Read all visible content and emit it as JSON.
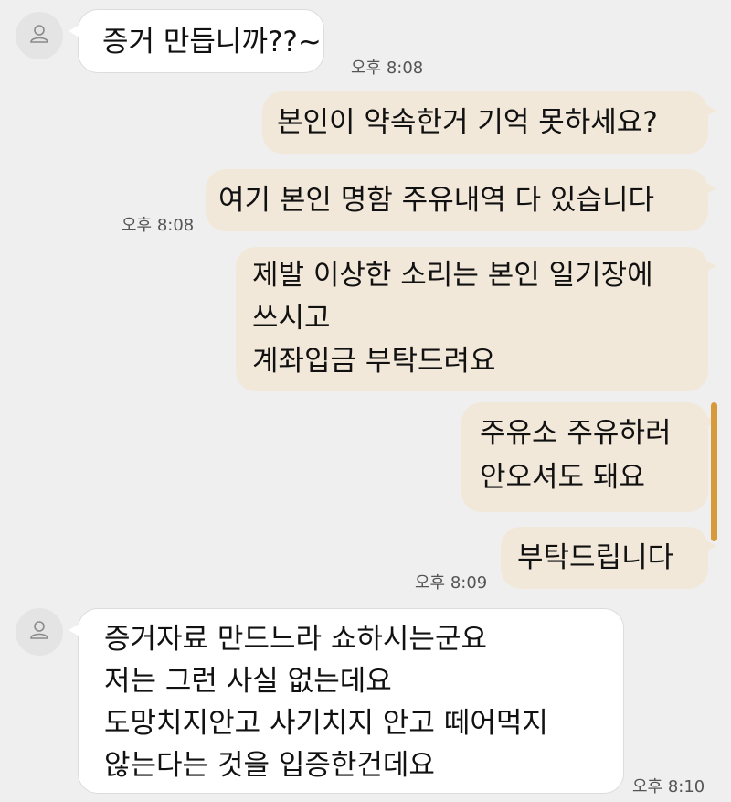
{
  "messages": [
    {
      "direction": "in",
      "lines": [
        "증거 만듭니까??~"
      ],
      "time": "오후 8:08"
    },
    {
      "direction": "out",
      "lines": [
        "본인이 약속한거 기억 못하세요?"
      ]
    },
    {
      "direction": "out",
      "lines": [
        "여기 본인 명함 주유내역 다 있습니다"
      ],
      "time": "오후 8:08"
    },
    {
      "direction": "out",
      "lines": [
        "제발 이상한 소리는 본인 일기장에",
        "쓰시고",
        "계좌입금 부탁드려요"
      ]
    },
    {
      "direction": "out",
      "lines": [
        "주유소 주유하러",
        "안오셔도 돼요"
      ]
    },
    {
      "direction": "out",
      "lines": [
        "부탁드립니다"
      ],
      "time": "오후 8:09"
    },
    {
      "direction": "in",
      "lines": [
        "증거자료 만드느라 쇼하시는군요",
        "저는 그런 사실 없는데요",
        "도망치지안고 사기치지 안고 떼어먹지",
        "않는다는 것을 입증한건데요"
      ],
      "time": "오후 8:10"
    }
  ],
  "colors": {
    "background": "#efefef",
    "incoming_bubble": "#ffffff",
    "outgoing_bubble": "#f2e8da",
    "scrollbar": "#d79a3a"
  },
  "icons": {
    "avatar": "person-outline-icon"
  }
}
